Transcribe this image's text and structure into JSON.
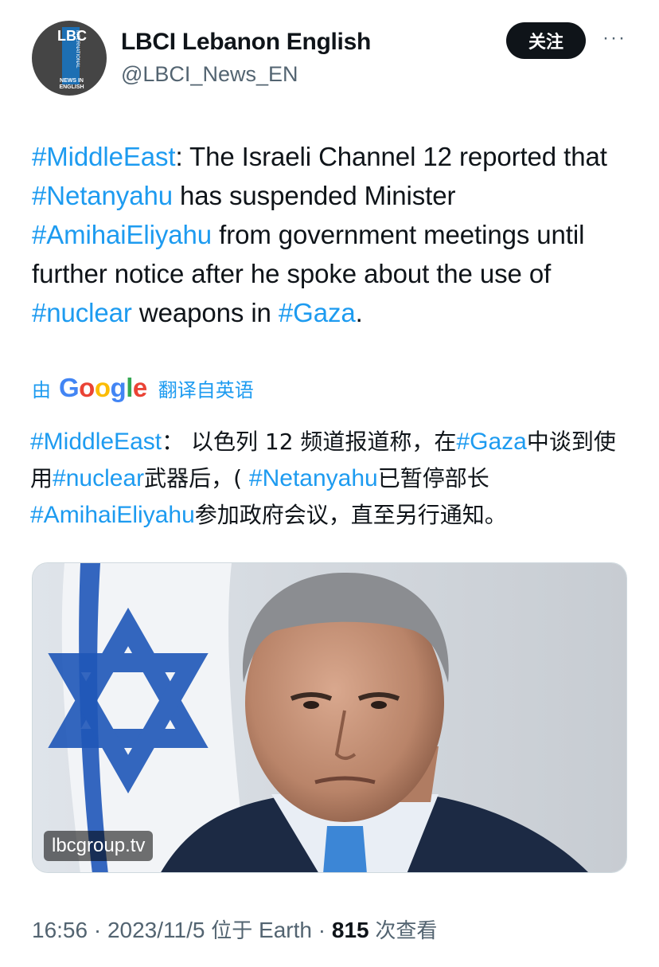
{
  "account": {
    "name": "LBCI Lebanon English",
    "handle": "@LBCI_News_EN",
    "avatar_letters": "LBC",
    "avatar_sub": "NEWS IN ENGLISH",
    "avatar_vertical": "INTERNATIONAL",
    "follow_label": "关注",
    "more_label": "···"
  },
  "tweet": {
    "p1_tag": "#MiddleEast",
    "p1_text": ": The Israeli Channel 12 reported that ",
    "p2_tag": "#Netanyahu",
    "p2_text": " has suspended Minister ",
    "p3_tag": "#AmihaiEliyahu",
    "p3_text": " from government meetings until further notice after he spoke about the use of ",
    "p4_tag": "#nuclear",
    "p4_text": " weapons in ",
    "p5_tag": "#Gaza",
    "p5_text": "."
  },
  "translation": {
    "by": "由",
    "provider": "Google",
    "from": "翻译自英语",
    "t1_tag": "#MiddleEast",
    "t1_text": "： 以色列 12 频道报道称，在",
    "t2_tag": "#Gaza",
    "t2_text": "中谈到使用",
    "t3_tag": "#nuclear",
    "t3_text": "武器后，( ",
    "t4_tag": "#Netanyahu",
    "t4_text": "已暂停部长",
    "t5_tag": "#AmihaiEliyahu",
    "t5_text": "参加政府会议，直至另行通知。"
  },
  "media": {
    "source": "lbcgroup.tv"
  },
  "meta": {
    "time": "16:56",
    "date": "2023/11/5",
    "location_prefix": "位于",
    "location": "Earth",
    "views": "815",
    "views_label": "次查看",
    "sep": "·"
  },
  "colors": {
    "link": "#1d9bf0",
    "text": "#0f1419",
    "secondary": "#536471",
    "button_bg": "#0f1419"
  }
}
